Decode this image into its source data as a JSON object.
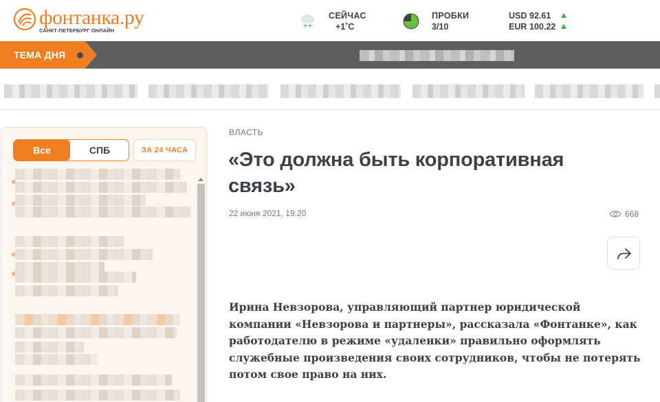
{
  "header": {
    "logo_text": "фонтанка.ру",
    "logo_subtitle": "САНКТ-ПЕТЕРБУРГ ОНЛАЙН",
    "weather": {
      "label": "СЕЙЧАС",
      "value": "+1˚C",
      "icon": "snow-cloud-icon"
    },
    "traffic": {
      "label": "ПРОБКИ",
      "value": "3/10",
      "icon": "traffic-light-icon"
    },
    "currency": [
      {
        "code": "USD",
        "value": "92.61",
        "trend": "up"
      },
      {
        "code": "EUR",
        "value": "100.22",
        "trend": "up"
      }
    ]
  },
  "topic_bar": {
    "label": "ТЕМА ДНЯ"
  },
  "sidebar": {
    "filter_all": "Все",
    "filter_spb": "СПБ",
    "period": "ЗА 24 ЧАСА"
  },
  "article": {
    "rubric": "ВЛАСТЬ",
    "title": "«Это должна быть корпоративная связь»",
    "date": "22 июня 2021, 19:20",
    "views": "668",
    "lead": "Ирина Невзорова, управляющий партнер юридической компании «Невзорова и партнеры», рассказала «Фонтанке», как работодателю в режиме «удаленки» правильно оформлять служебные произведения своих сотрудников, чтобы не потерять потом свое право на них."
  },
  "colors": {
    "brand_orange": "#ef7d22",
    "topic_bar_bg": "#5d5e5f",
    "trend_up": "#3bb34a",
    "traffic_green": "#6abf3b"
  }
}
